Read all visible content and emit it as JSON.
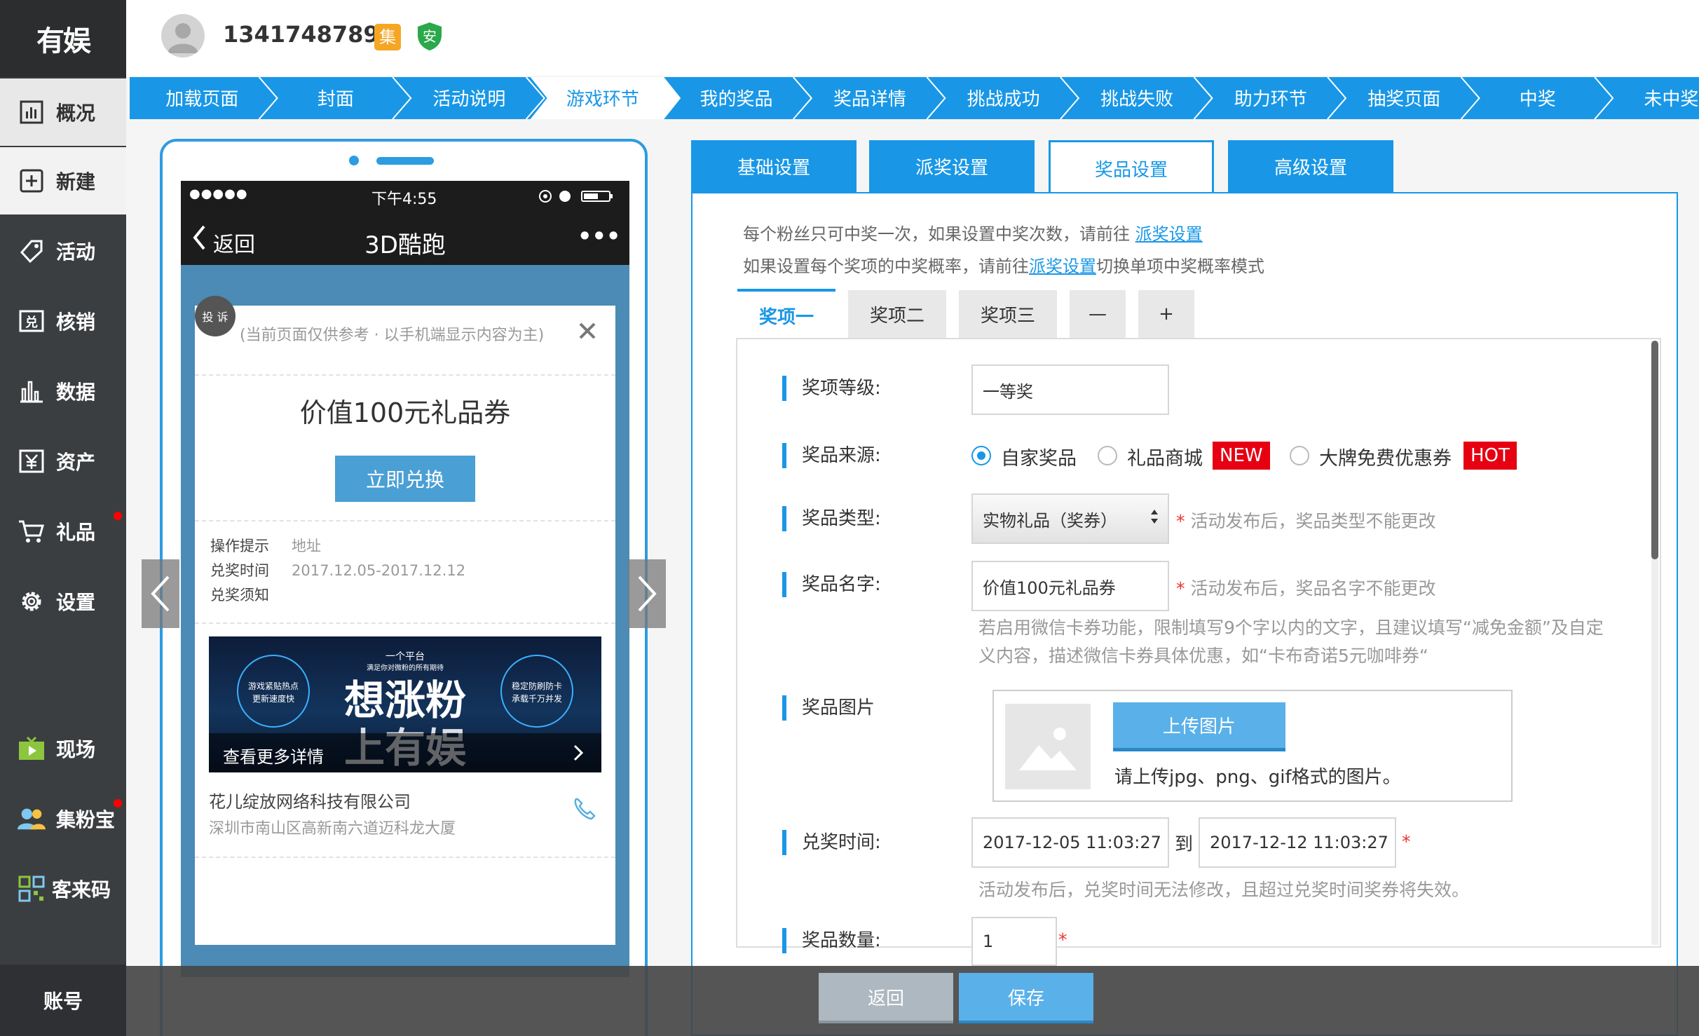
{
  "sidebar": {
    "logo": "有娱",
    "items": [
      {
        "label": "概况",
        "icon": "chart-icon"
      },
      {
        "label": "新建",
        "icon": "plus-square-icon"
      },
      {
        "label": "活动",
        "icon": "tag-icon"
      },
      {
        "label": "核销",
        "icon": "redeem-icon"
      },
      {
        "label": "数据",
        "icon": "bar-chart-icon"
      },
      {
        "label": "资产",
        "icon": "yen-icon"
      },
      {
        "label": "礼品",
        "icon": "cart-icon"
      },
      {
        "label": "设置",
        "icon": "gear-icon"
      },
      {
        "label": "现场",
        "icon": "tv-icon"
      },
      {
        "label": "集粉宝",
        "icon": "users-icon"
      },
      {
        "label": "客来码",
        "icon": "qr-icon"
      }
    ],
    "account": "账号"
  },
  "header": {
    "phone": "13417487894",
    "badge_ji": "集",
    "badge_an": "安"
  },
  "steps": [
    "加载页面",
    "封面",
    "活动说明",
    "游戏环节",
    "我的奖品",
    "奖品详情",
    "挑战成功",
    "挑战失败",
    "助力环节",
    "抽奖页面",
    "中奖",
    "未中奖"
  ],
  "preview": {
    "signal": "●●●●●",
    "time": "下午4:55",
    "back": "返回",
    "title": "3D酷跑",
    "more": "•••",
    "complaint": "投 诉",
    "notice": "(当前页面仅供参考 · 以手机端显示内容为主)",
    "prize_title": "价值100元礼品券",
    "redeem_button": "立即兑换",
    "info_labels": [
      "操作提示",
      "兑奖时间",
      "兑奖须知"
    ],
    "info_values": [
      "地址",
      "2017.12.05-2017.12.12",
      ""
    ],
    "banner_top": "一个平台",
    "banner_sub": "满足你对微粉的所有期待",
    "banner_left": "游戏紧贴热点\n更新速度快",
    "banner_right": "稳定防刷防卡\n承载千万并发",
    "banner_big1": "想涨粉",
    "banner_big2": "上有娱",
    "banner_more": "查看更多详情",
    "company": "花儿绽放网络科技有限公司",
    "address": "深圳市南山区高新南六道迈科龙大厦"
  },
  "settings_tabs": [
    "基础设置",
    "派奖设置",
    "奖品设置",
    "高级设置"
  ],
  "hints": {
    "line1_pre": "每个粉丝只可中奖一次，如果设置中奖次数，请前往 ",
    "line1_link": "派奖设置",
    "line2_pre": "如果设置每个奖项的中奖概率，请前往",
    "line2_link": "派奖设置",
    "line2_post": "切换单项中奖概率模式"
  },
  "prize_tabs": [
    "奖项一",
    "奖项二",
    "奖项三",
    "—",
    "+"
  ],
  "form": {
    "level_label": "奖项等级:",
    "level_value": "一等奖",
    "source_label": "奖品来源:",
    "source_options": [
      "自家奖品",
      "礼品商城",
      "大牌免费优惠券"
    ],
    "source_selected": 0,
    "tag_new": "NEW",
    "tag_hot": "HOT",
    "type_label": "奖品类型:",
    "type_value": "实物礼品（奖券）",
    "type_note": "活动发布后，奖品类型不能更改",
    "name_label": "奖品名字:",
    "name_value": "价值100元礼品券",
    "name_note": "活动发布后，奖品名字不能更改",
    "name_tip1": "若启用微信卡券功能，限制填写9个字以内的文字，且建议填写“减免金额”及自定",
    "name_tip2": "义内容，描述微信卡券具体优惠，如“卡布奇诺5元咖啡券“",
    "image_label": "奖品图片",
    "upload_button": "上传图片",
    "upload_note": "请上传jpg、png、gif格式的图片。",
    "time_label": "兑奖时间:",
    "time_start": "2017-12-05 11:03:27",
    "time_to": "到",
    "time_end": "2017-12-12 11:03:27",
    "time_note": "活动发布后，兑奖时间无法修改，且超过兑奖时间奖券将失效。",
    "qty_label": "奖品数量:",
    "qty_value": "1",
    "required_mark": "*"
  },
  "bottom": {
    "back": "返回",
    "save": "保存"
  },
  "colors": {
    "primary": "#1997e6",
    "sidebar": "#3b3e41",
    "danger": "#e60012"
  }
}
